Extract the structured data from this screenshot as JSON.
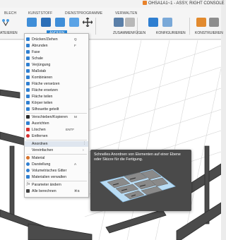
{
  "window": {
    "document_title": "OHSA1A1~1 - ASSY, RIGHT CONSOLE"
  },
  "ribbon": {
    "tabs": [
      "BLECH",
      "KUNSTSTOFF",
      "DIENSTPROGRAMME",
      "VERWALTEN"
    ],
    "groups": {
      "partial_left": "ATEIEREN",
      "aendern": "ÄNDERN",
      "zusammenfuegen": "ZUSAMMENFÜGEN",
      "konfigurieren": "KONFIGURIEREN",
      "konstruieren": "KONSTRUIEREN"
    }
  },
  "menu": {
    "items": [
      {
        "label": "Drücken/Ziehen",
        "shortcut": "Q",
        "icon": "press-pull-icon",
        "color": "#2f7fd1"
      },
      {
        "label": "Abrunden",
        "shortcut": "F",
        "icon": "fillet-icon",
        "color": "#2f7fd1"
      },
      {
        "label": "Fase",
        "shortcut": "",
        "icon": "chamfer-icon",
        "color": "#2f7fd1"
      },
      {
        "label": "Schale",
        "shortcut": "",
        "icon": "shell-icon",
        "color": "#2f7fd1"
      },
      {
        "label": "Verjüngung",
        "shortcut": "",
        "icon": "draft-icon",
        "color": "#2f7fd1"
      },
      {
        "label": "Maßstab",
        "shortcut": "",
        "icon": "scale-icon",
        "color": "#2f7fd1"
      },
      {
        "label": "Kombinieren",
        "shortcut": "",
        "icon": "combine-icon",
        "color": "#2f7fd1"
      },
      {
        "label": "Fläche versetzen",
        "shortcut": "",
        "icon": "offset-face-icon",
        "color": "#2f7fd1"
      },
      {
        "label": "Fläche ersetzen",
        "shortcut": "",
        "icon": "replace-face-icon",
        "color": "#2f7fd1"
      },
      {
        "label": "Fläche teilen",
        "shortcut": "",
        "icon": "split-face-icon",
        "color": "#2f7fd1"
      },
      {
        "label": "Körper teilen",
        "shortcut": "",
        "icon": "split-body-icon",
        "color": "#2f7fd1"
      },
      {
        "label": "Silhouette geteilt",
        "shortcut": "",
        "icon": "silhouette-split-icon",
        "color": "#2f7fd1"
      },
      {
        "label": "Verschieben/Kopieren",
        "shortcut": "M",
        "icon": "move-icon",
        "color": "#2a2a2a"
      },
      {
        "label": "Ausrichten",
        "shortcut": "",
        "icon": "align-icon",
        "color": "#2f7fd1"
      },
      {
        "label": "Löschen",
        "shortcut": "ENTF",
        "icon": "delete-icon",
        "color": "#d83030"
      },
      {
        "label": "Entfernen",
        "shortcut": "",
        "icon": "remove-icon",
        "color": "#d83030"
      },
      {
        "label": "Anordnen",
        "shortcut": "",
        "icon": "arrange-icon",
        "color": "#6a6a6a"
      },
      {
        "label": "Vereinfachen",
        "shortcut": "",
        "icon": "simplify-icon",
        "color": "#6a6a6a"
      },
      {
        "label": "Material",
        "shortcut": "",
        "icon": "material-icon",
        "color": "#d8722a"
      },
      {
        "label": "Darstellung",
        "shortcut": "A",
        "icon": "appearance-icon",
        "color": "#2f7fd1"
      },
      {
        "label": "Volumetrisches Gitter",
        "shortcut": "",
        "icon": "volumetric-lattice-icon",
        "color": "#2f7fd1"
      },
      {
        "label": "Materialien verwalten",
        "shortcut": "",
        "icon": "manage-materials-icon",
        "color": "#2f7fd1"
      },
      {
        "label": "Parameter ändern",
        "shortcut": "",
        "icon": "parameters-icon",
        "color": "#444444"
      },
      {
        "label": "Alle berechnen",
        "shortcut": "⌘B",
        "icon": "compute-all-icon",
        "color": "#444444"
      }
    ]
  },
  "tooltip": {
    "text": "Schnelles Anordnen von Elementen auf einer Ebene oder Skizze für die Fertigung."
  }
}
